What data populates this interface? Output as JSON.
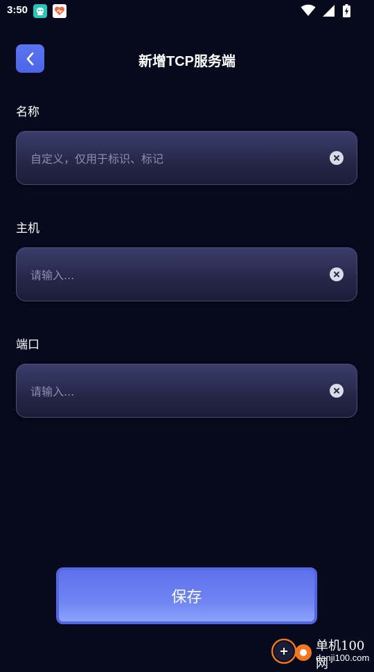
{
  "status_bar": {
    "time": "3:50",
    "notif_icons": [
      "robot-app-icon",
      "heart-app-icon"
    ],
    "right_icons": [
      "wifi-icon",
      "signal-icon",
      "battery-charging-icon"
    ]
  },
  "header": {
    "back_icon": "chevron-left-icon",
    "title": "新增TCP服务端"
  },
  "form": {
    "name": {
      "label": "名称",
      "value": "",
      "placeholder": "自定义，仅用于标识、标记"
    },
    "host": {
      "label": "主机",
      "value": "",
      "placeholder": "请输入..."
    },
    "port": {
      "label": "端口",
      "value": "",
      "placeholder": "请输入..."
    }
  },
  "actions": {
    "save_label": "保存"
  },
  "watermark": {
    "title": "单机100网",
    "domain": "danji100.com"
  },
  "colors": {
    "background": "#070a1c",
    "accent": "#5b74f1",
    "field_bg": "#26284a",
    "placeholder": "#8b8eb0"
  }
}
